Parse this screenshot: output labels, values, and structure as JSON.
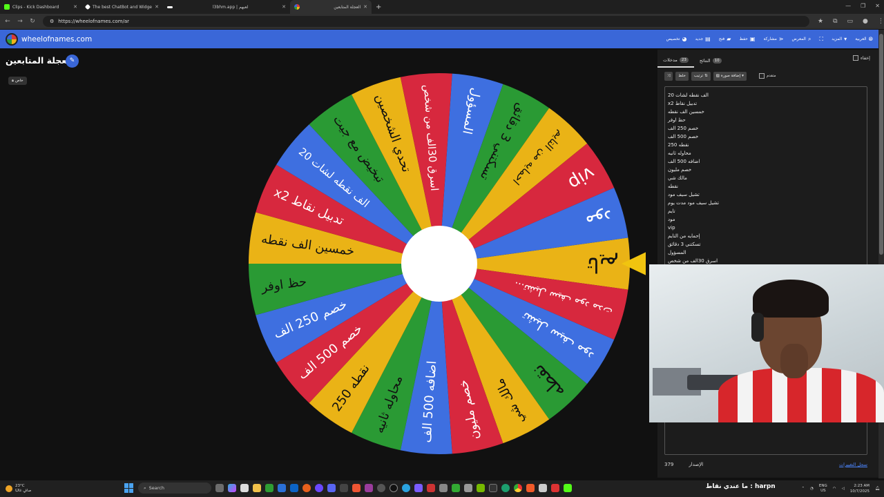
{
  "browser": {
    "tabs": [
      {
        "title": "Clips - Kick Dashboard",
        "color": "#53fc18"
      },
      {
        "title": "The best ChatBot and Widgets",
        "color": "#ffffff"
      },
      {
        "title": "",
        "color": "#ffffff"
      },
      {
        "title": "l3bhm.app | لعبهم",
        "color": "#6c3cf0"
      },
      {
        "title": "العجلة المتابعين",
        "color": "#d83a3a"
      }
    ],
    "url": "https://wheelofnames.com/ar"
  },
  "site": {
    "name": "wheelofnames.com",
    "menu": [
      {
        "label": "العربية",
        "icon": "globe-icon"
      },
      {
        "label": "المزيد",
        "icon": "chevron-down-icon"
      },
      {
        "label": "",
        "icon": "fullscreen-icon"
      },
      {
        "label": "المعرض",
        "icon": "search-icon"
      },
      {
        "label": "مشاركة",
        "icon": "share-icon"
      },
      {
        "label": "حفظ",
        "icon": "save-icon"
      },
      {
        "label": "فتح",
        "icon": "folder-icon"
      },
      {
        "label": "جديد",
        "icon": "new-file-icon"
      },
      {
        "label": "تخصيص",
        "icon": "palette-icon"
      }
    ]
  },
  "wheel_title": "العجلة المتابعين",
  "share_badge": "خاص",
  "wheel": {
    "colors": [
      "#eab316",
      "#d7283e",
      "#3e6fe0",
      "#2a9a34"
    ],
    "pointer_color": "#f1c40f",
    "segments": [
      "تايم",
      "تشيل سيف مود مدت...",
      "تشيل سيف مود",
      "نقطه",
      "مالك شي",
      "خصم مليون",
      "اضافه 500 الف",
      "محاوله ثانيه",
      "250 نقطه",
      "خصم 500 الف",
      "خصم 250 الف",
      "حظ اوفر",
      "خمسين الف نقطه",
      "x2 تدبيل نقاط",
      "20 الف نقطه لشات",
      "تبخيض مع جيت",
      "تحدي الشخصين",
      "اسرق 30الف من شخص",
      "المسؤول",
      "تسكتني 3 دقائق",
      "احمايه من التايم",
      "vip",
      "مود"
    ]
  },
  "panel": {
    "tabs": [
      {
        "label": "مدخلات",
        "count": "23"
      },
      {
        "label": "النتائج",
        "count": "10"
      }
    ],
    "hide_label": "إخفاء",
    "tools": {
      "shuffle": "خلط",
      "sort": "ترتيب",
      "image": "إضافة صورة",
      "advanced": "متقدم"
    },
    "entries": [
      "20 الف نقطه لشات",
      "x2 تدبيل نقاط",
      "خمسين الف نقطه",
      "حظ اوفر",
      "خصم 250 الف",
      "خصم 500 الف",
      "250 نقطه",
      "محاوله ثانيه",
      "اضافه 500 الف",
      "خصم مليون",
      "مالك شي",
      "نقطه",
      "تشيل سيف مود",
      "تشيل سيف مود مدت يوم",
      "تايم",
      "مود",
      "vip",
      "إحمايه من التايم",
      "تسكتني 3 دقائق",
      "المسؤول",
      "اسرق 30الف من شخص"
    ],
    "footer_left_label": "الإصدار",
    "footer_left_value": "379",
    "footer_right": "سجل التغييرات"
  },
  "overlay_text": "harpn : ما عندي نقاط",
  "taskbar": {
    "weather_temp": "23°C",
    "weather_desc": "صافٍ غالبًا",
    "search": "Search",
    "lang_top": "ENG",
    "lang_bottom": "US",
    "time": "2:23 AM",
    "date": "10/7/2025"
  }
}
